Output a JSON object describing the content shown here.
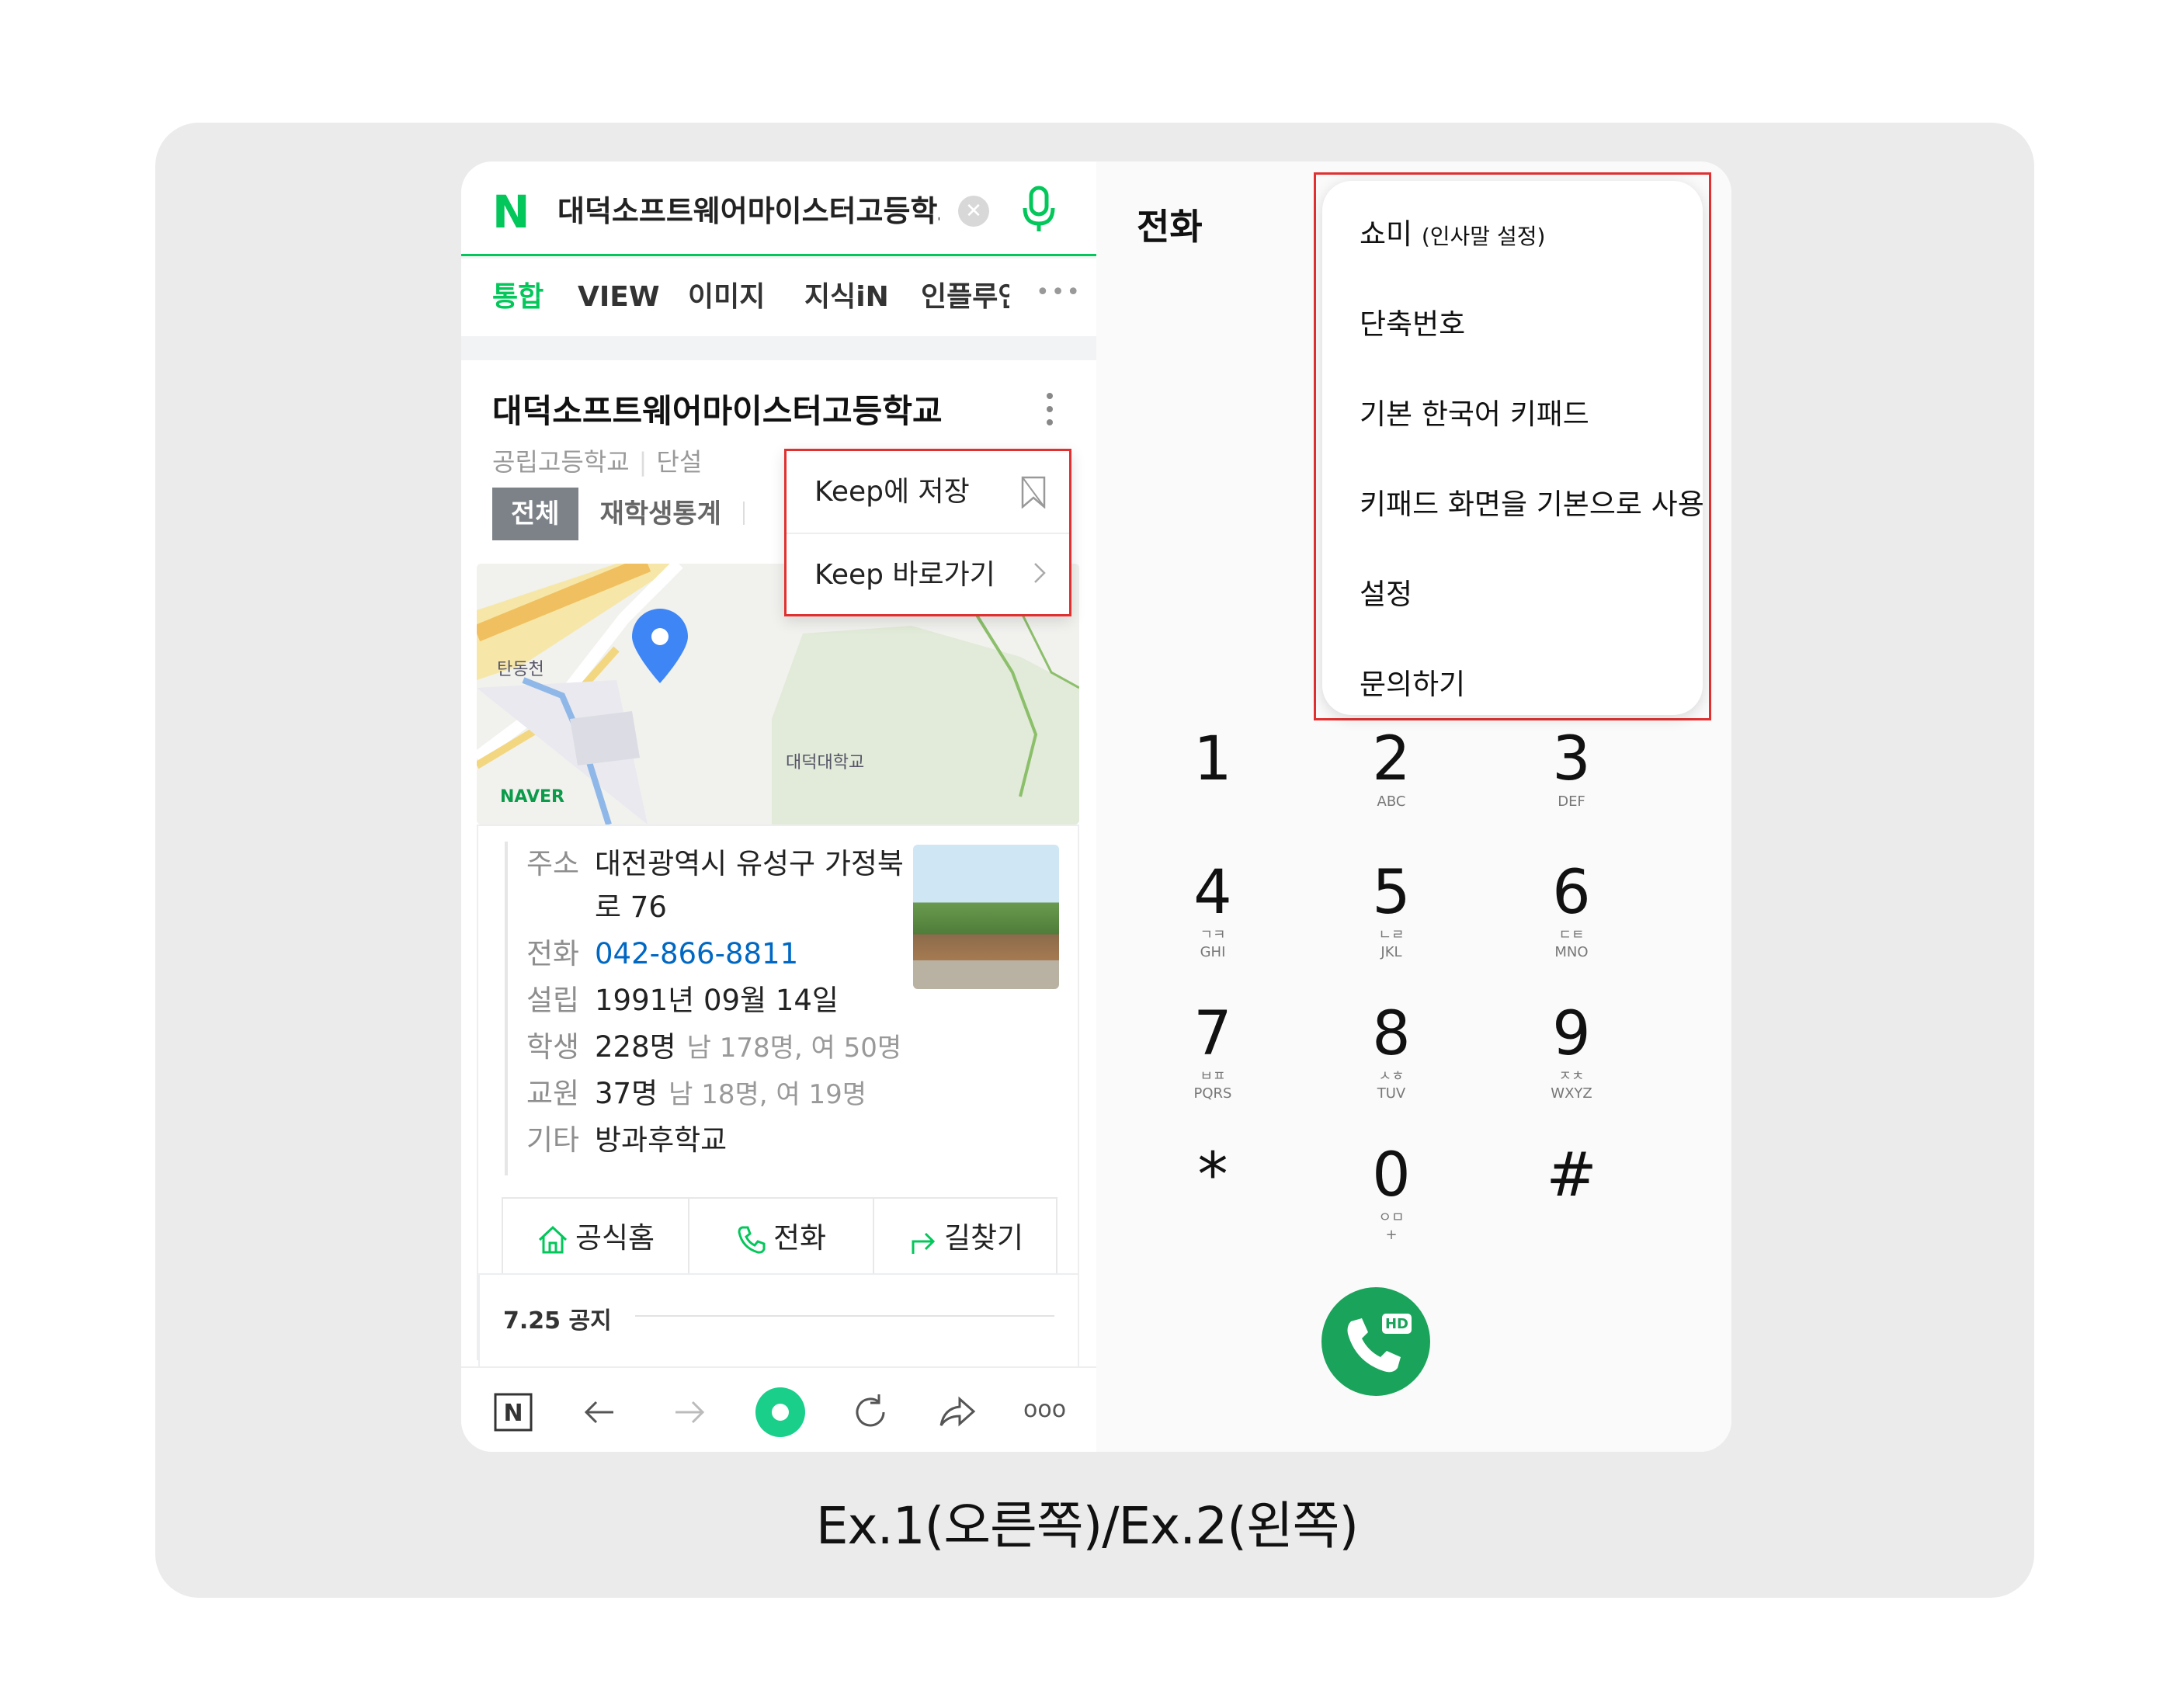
{
  "caption": "Ex.1(오른쪽)/Ex.2(왼쪽)",
  "browser": {
    "logo": "N",
    "query": "대덕소프트웨어마이스터고등학교",
    "tabs": [
      "통합",
      "VIEW",
      "이미지",
      "지식iN",
      "인플루언서"
    ],
    "more": "•••",
    "result": {
      "title": "대덕소프트웨어마이스터고등학교",
      "category": "공립고등학교",
      "category2": "단설",
      "chips": [
        "전체",
        "재학생통계"
      ],
      "map_labels": [
        "탄동천",
        "대덕대학교"
      ],
      "map_brand": "NAVER",
      "details": [
        {
          "key": "주소",
          "value": "대전광역시 유성구 가정북",
          "value2": "로 76"
        },
        {
          "key": "전화",
          "value": "042-866-8811"
        },
        {
          "key": "설립",
          "value": "1991년 09월 14일"
        },
        {
          "key": "학생",
          "value": "228명",
          "extra": "남 178명, 여 50명"
        },
        {
          "key": "교원",
          "value": "37명",
          "extra": "남 18명, 여 19명"
        },
        {
          "key": "기타",
          "value": "방과후학교"
        }
      ],
      "actions": [
        "공식홈",
        "전화",
        "길찾기"
      ],
      "notice": "7.25 공지"
    },
    "keep_menu": [
      "Keep에 저장",
      "Keep 바로가기"
    ],
    "bottom_nav_logo": "N",
    "bottom_more": "ooo"
  },
  "dialer": {
    "title": "전화",
    "menu": [
      {
        "label": "쇼미",
        "note": "(인사말 설정)"
      },
      {
        "label": "단축번호"
      },
      {
        "label": "기본 한국어 키패드"
      },
      {
        "label": "키패드 화면을 기본으로 사용"
      },
      {
        "label": "설정"
      },
      {
        "label": "문의하기"
      }
    ],
    "keys": [
      {
        "digit": "1",
        "sub": ""
      },
      {
        "digit": "2",
        "sub": "ABC"
      },
      {
        "digit": "3",
        "sub": "DEF"
      },
      {
        "digit": "4",
        "sub": "ㄱㅋ",
        "sub2": "GHI"
      },
      {
        "digit": "5",
        "sub": "ㄴㄹ",
        "sub2": "JKL"
      },
      {
        "digit": "6",
        "sub": "ㄷㅌ",
        "sub2": "MNO"
      },
      {
        "digit": "7",
        "sub": "ㅂㅍ",
        "sub2": "PQRS"
      },
      {
        "digit": "8",
        "sub": "ㅅㅎ",
        "sub2": "TUV"
      },
      {
        "digit": "9",
        "sub": "ㅈㅊ",
        "sub2": "WXYZ"
      },
      {
        "digit": "*",
        "sub": ""
      },
      {
        "digit": "0",
        "sub": "ㅇㅁ",
        "sub2": "+"
      },
      {
        "digit": "#",
        "sub": ""
      }
    ],
    "call_badge": "HD"
  },
  "colors": {
    "naver_green": "#03c75a",
    "call_green": "#1aa35a",
    "highlight_red": "#e03030",
    "link_blue": "#0068c3"
  }
}
